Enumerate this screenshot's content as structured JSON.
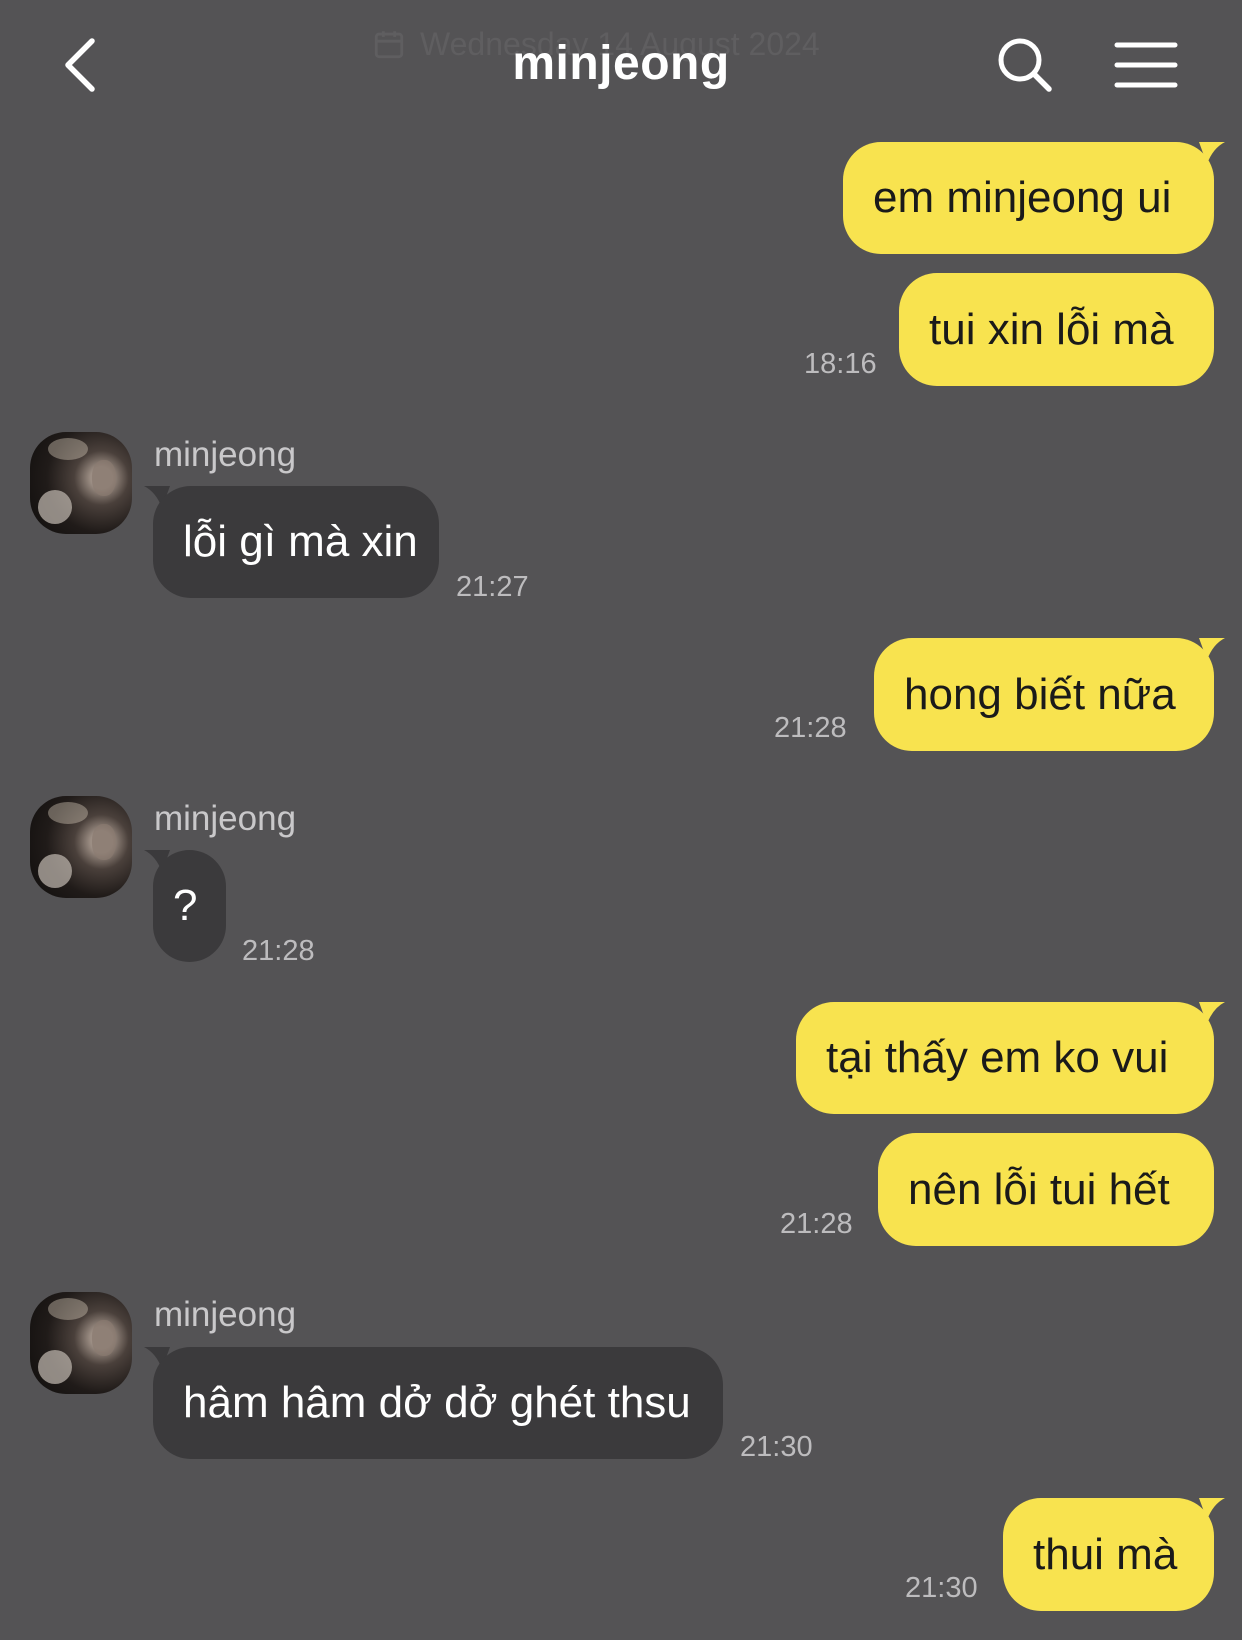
{
  "header": {
    "date_ghost": "Wednesday 14 August 2024",
    "title": "minjeong",
    "back_icon": "chevron-left-icon",
    "search_icon": "search-icon",
    "menu_icon": "menu-icon"
  },
  "colors": {
    "background": "#545355",
    "outgoing_bubble": "#f8e34f",
    "incoming_bubble": "#3b3a3c"
  },
  "messages": [
    {
      "from": "me",
      "text": "em minjeong ui"
    },
    {
      "from": "me",
      "text": "tui xin lỗi mà",
      "time": "18:16"
    },
    {
      "from": "them",
      "sender": "minjeong",
      "text": "lỗi gì mà xin",
      "time": "21:27"
    },
    {
      "from": "me",
      "text": "hong biết nữa",
      "time": "21:28"
    },
    {
      "from": "them",
      "sender": "minjeong",
      "text": "?",
      "time": "21:28"
    },
    {
      "from": "me",
      "text": "tại thấy em ko vui"
    },
    {
      "from": "me",
      "text": "nên lỗi tui hết",
      "time": "21:28"
    },
    {
      "from": "them",
      "sender": "minjeong",
      "text": "hâm hâm dở dở ghét thsu",
      "time": "21:30"
    },
    {
      "from": "me",
      "text": "thui mà",
      "time": "21:30"
    }
  ]
}
